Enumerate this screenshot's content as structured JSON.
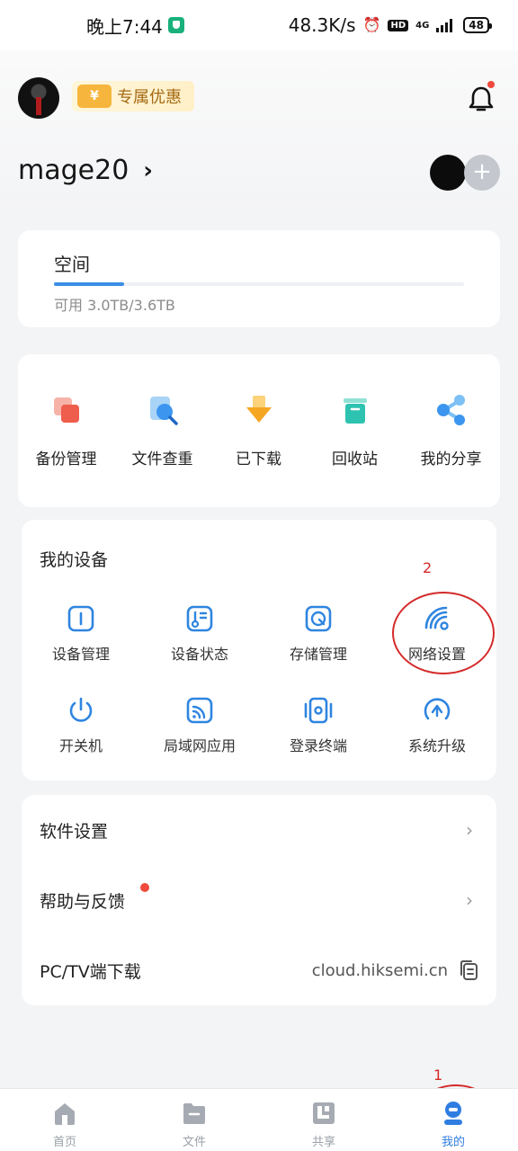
{
  "status_bar": {
    "time": "晚上7:44",
    "net_speed": "48.3K/s",
    "hd": "HD",
    "signal": "4G",
    "battery": "48"
  },
  "header": {
    "promo_label": "专属优惠",
    "promo_icon_text": "¥",
    "username": "mage20",
    "add_symbol": "+"
  },
  "space": {
    "title": "空间",
    "usage_text": "可用 3.0TB/3.6TB",
    "used_fraction": 0.17
  },
  "tools": [
    {
      "label": "备份管理",
      "icon": "backup-icon"
    },
    {
      "label": "文件查重",
      "icon": "file-dedupe-icon"
    },
    {
      "label": "已下载",
      "icon": "downloaded-icon"
    },
    {
      "label": "回收站",
      "icon": "recycle-bin-icon"
    },
    {
      "label": "我的分享",
      "icon": "share-icon"
    }
  ],
  "devices": {
    "title": "我的设备",
    "items": [
      {
        "label": "设备管理",
        "icon": "device-manage-icon"
      },
      {
        "label": "设备状态",
        "icon": "device-status-icon"
      },
      {
        "label": "存储管理",
        "icon": "storage-manage-icon"
      },
      {
        "label": "网络设置",
        "icon": "network-settings-icon"
      },
      {
        "label": "开关机",
        "icon": "power-icon"
      },
      {
        "label": "局域网应用",
        "icon": "lan-apps-icon"
      },
      {
        "label": "登录终端",
        "icon": "login-terminal-icon"
      },
      {
        "label": "系统升级",
        "icon": "system-upgrade-icon"
      }
    ]
  },
  "settings": {
    "software": "软件设置",
    "help": "帮助与反馈",
    "pc_tv": "PC/TV端下载",
    "pc_tv_url": "cloud.hiksemi.cn",
    "chevron": "›"
  },
  "annotations": {
    "one": "1",
    "two": "2"
  },
  "bottom_nav": [
    {
      "label": "首页",
      "icon": "home-icon",
      "active": false
    },
    {
      "label": "文件",
      "icon": "folder-icon",
      "active": false
    },
    {
      "label": "共享",
      "icon": "shared-icon",
      "active": false
    },
    {
      "label": "我的",
      "icon": "profile-icon",
      "active": true
    }
  ],
  "colors": {
    "accent": "#2f7de1",
    "annotation": "#d42a2a",
    "notification_dot": "#ef4a3d"
  }
}
